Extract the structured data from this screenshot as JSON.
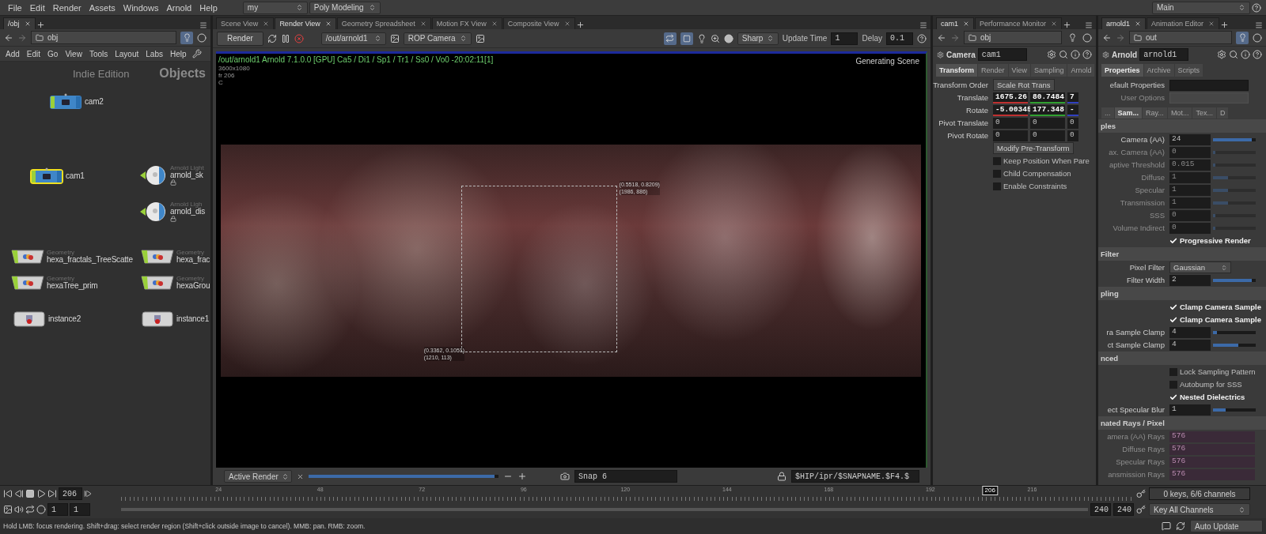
{
  "menubar": {
    "menus": [
      "File",
      "Edit",
      "Render",
      "Assets",
      "Windows",
      "Arnold",
      "Help"
    ],
    "desktop": "my",
    "shelf_set": "Poly Modeling",
    "context": "Main"
  },
  "network_pane": {
    "tabs": [
      {
        "label": "/obj",
        "selected": true
      }
    ],
    "path": "obj",
    "menus": [
      "Add",
      "Edit",
      "Go",
      "View",
      "Tools",
      "Layout",
      "Labs",
      "Help"
    ],
    "edition": "Indie Edition",
    "context_label": "Objects",
    "nodes": [
      {
        "kind": "camera",
        "name": "cam2",
        "selected": false
      },
      {
        "kind": "camera",
        "name": "cam1",
        "selected": true
      },
      {
        "kind": "light",
        "type_label": "Arnold Light",
        "name": "arnold_sk",
        "selected": false
      },
      {
        "kind": "light",
        "type_label": "Arnold Ligh",
        "name": "arnold_dis",
        "selected": false
      },
      {
        "kind": "geometry",
        "type_label": "Geometry",
        "name": "hexa_fractals_TreeScatte",
        "selected": false
      },
      {
        "kind": "geometry",
        "type_label": "Geometry",
        "name": "hexa_frac",
        "selected": false
      },
      {
        "kind": "geometry",
        "type_label": "Geometry",
        "name": "hexaTree_prim",
        "selected": false
      },
      {
        "kind": "geometry",
        "type_label": "Geometry",
        "name": "hexaGrou",
        "selected": false
      },
      {
        "kind": "instance",
        "name": "instance2",
        "selected": false
      },
      {
        "kind": "instance",
        "name": "instance1",
        "selected": false
      }
    ]
  },
  "viewer_pane": {
    "tabs": [
      {
        "label": "Scene View",
        "selected": false
      },
      {
        "label": "Render View",
        "selected": true
      },
      {
        "label": "Geometry Spreadsheet",
        "selected": false
      },
      {
        "label": "Motion FX View",
        "selected": false
      },
      {
        "label": "Composite View",
        "selected": false
      }
    ],
    "toolbar": {
      "render_button": "Render",
      "rop": "/out/arnold1",
      "camera": "ROP Camera",
      "preview": "Sharp",
      "update_time_label": "Update Time",
      "update_time": "1",
      "delay_label": "Delay",
      "delay": "0.1"
    },
    "hud": {
      "status_line": "/out/arnold1 Arnold 7.1.0.0 [GPU] Ca5 / Di1 / Sp1 / Tr1 / Ss0 / Vo0 -20:02:11[1]",
      "resolution": "3600x1080",
      "frame": "fr 206",
      "channel": "C",
      "progress": "Generating Scene"
    },
    "region": {
      "top_right": [
        "(0.5518, 0.8209)",
        "(1986, 886)"
      ],
      "bottom_left": [
        "(0.3362, 0.1051)",
        "(1210, 113)"
      ]
    },
    "bottom_bar": {
      "mode": "Active Render",
      "level": 0.98,
      "snap": "Snap 6",
      "snapshot_path": "$HIP/ipr/$SNAPNAME.$F4.$"
    }
  },
  "cam_pane": {
    "tabs": [
      {
        "label": "cam1",
        "selected": true
      },
      {
        "label": "Performance Monitor",
        "selected": false
      }
    ],
    "path": "obj",
    "node_type": "Camera",
    "node_name": "cam1",
    "param_tabs": [
      {
        "label": "Transform",
        "selected": true
      },
      {
        "label": "Render",
        "selected": false
      },
      {
        "label": "View",
        "selected": false
      },
      {
        "label": "Sampling",
        "selected": false
      },
      {
        "label": "Arnold",
        "selected": false
      }
    ],
    "params": [
      {
        "kind": "dropdown",
        "label": "Transform Order",
        "value": "Scale Rot Trans"
      },
      {
        "kind": "vector",
        "label": "Translate",
        "values": [
          "1675.26",
          "80.7484",
          "7"
        ],
        "keyed": true
      },
      {
        "kind": "vector",
        "label": "Rotate",
        "values": [
          "-5.00345",
          "177.348",
          "-"
        ],
        "keyed": true
      },
      {
        "kind": "vector",
        "label": "Pivot Translate",
        "values": [
          "0",
          "0",
          "0"
        ],
        "keyed": false
      },
      {
        "kind": "vector",
        "label": "Pivot Rotate",
        "values": [
          "0",
          "0",
          "0"
        ],
        "keyed": false
      },
      {
        "kind": "button",
        "label": "Modify Pre-Transform"
      },
      {
        "kind": "checkbox",
        "label": "Keep Position When Pare",
        "checked": false
      },
      {
        "kind": "checkbox",
        "label": "Child Compensation",
        "checked": false
      },
      {
        "kind": "checkbox",
        "label": "Enable Constraints",
        "checked": false
      }
    ]
  },
  "arnold_pane": {
    "tabs": [
      {
        "label": "arnold1",
        "selected": true
      },
      {
        "label": "Animation Editor",
        "selected": false
      }
    ],
    "path": "out",
    "node_type": "Arnold",
    "node_name": "arnold1",
    "param_tabs": [
      {
        "label": "Properties",
        "selected": true
      },
      {
        "label": "Archive",
        "selected": false
      },
      {
        "label": "Scripts",
        "selected": false
      }
    ],
    "params": [
      {
        "kind": "blank",
        "label": "efault Properties",
        "disabled": false
      },
      {
        "kind": "blank",
        "label": "User Options",
        "disabled": true
      },
      {
        "kind": "subtabs",
        "tabs": [
          {
            "label": "...",
            "selected": false
          },
          {
            "label": "Sam...",
            "selected": true
          },
          {
            "label": "Ray...",
            "selected": false
          },
          {
            "label": "Mot...",
            "selected": false
          },
          {
            "label": "Tex...",
            "selected": false
          },
          {
            "label": "D",
            "selected": false
          }
        ]
      },
      {
        "kind": "section",
        "label": "ples"
      },
      {
        "kind": "field",
        "label": "Camera (AA)",
        "value": "24",
        "disabled": false,
        "level": 0.9
      },
      {
        "kind": "field",
        "label": "ax. Camera (AA)",
        "value": "0",
        "disabled": true,
        "level": 0
      },
      {
        "kind": "field",
        "label": "aptive Threshold",
        "value": "0.015",
        "disabled": true,
        "level": 0
      },
      {
        "kind": "field",
        "label": "Diffuse",
        "value": "1",
        "disabled": true,
        "level": 0.35
      },
      {
        "kind": "field",
        "label": "Specular",
        "value": "1",
        "disabled": true,
        "level": 0.35
      },
      {
        "kind": "field",
        "label": "Transmission",
        "value": "1",
        "disabled": true,
        "level": 0.35
      },
      {
        "kind": "field",
        "label": "SSS",
        "value": "0",
        "disabled": true,
        "level": 0
      },
      {
        "kind": "field",
        "label": "Volume Indirect",
        "value": "0",
        "disabled": true,
        "level": 0
      },
      {
        "kind": "checkbox",
        "label": "Progressive Render",
        "checked": true
      },
      {
        "kind": "section",
        "label": "Filter"
      },
      {
        "kind": "dropdown",
        "label": "Pixel Filter",
        "value": "Gaussian"
      },
      {
        "kind": "field",
        "label": "Filter Width",
        "value": "2",
        "disabled": false,
        "level": 0.9
      },
      {
        "kind": "section",
        "label": "pling"
      },
      {
        "kind": "checkbox",
        "label": "Clamp Camera Sample",
        "checked": true
      },
      {
        "kind": "checkbox",
        "label": "Clamp Camera Sample",
        "checked": true
      },
      {
        "kind": "field",
        "label": "ra Sample Clamp",
        "value": "4",
        "disabled": false,
        "level": 0.1
      },
      {
        "kind": "field",
        "label": "ct Sample Clamp",
        "value": "4",
        "disabled": false,
        "level": 0.6
      },
      {
        "kind": "section",
        "label": "nced"
      },
      {
        "kind": "checkbox",
        "label": "Lock Sampling Pattern",
        "checked": false
      },
      {
        "kind": "checkbox",
        "label": "Autobump for SSS",
        "checked": false
      },
      {
        "kind": "checkbox",
        "label": "Nested Dielectrics",
        "checked": true
      },
      {
        "kind": "field",
        "label": "ect Specular Blur",
        "value": "1",
        "disabled": false,
        "level": 0.3
      },
      {
        "kind": "section",
        "label": "nated Rays / Pixel"
      },
      {
        "kind": "readout",
        "label": "amera (AA) Rays",
        "value": "576"
      },
      {
        "kind": "readout",
        "label": "Diffuse Rays",
        "value": "576"
      },
      {
        "kind": "readout",
        "label": "Specular Rays",
        "value": "576"
      },
      {
        "kind": "readout",
        "label": "ansmission Rays",
        "value": "576"
      }
    ]
  },
  "timeline": {
    "frame": "206",
    "ticks": [
      "24",
      "48",
      "72",
      "96",
      "120",
      "144",
      "168",
      "192",
      "216"
    ],
    "playhead": {
      "label": "206",
      "level": 0.858
    },
    "range": {
      "start": "1",
      "playback_start": "1",
      "playback_end": "240",
      "end": "240"
    },
    "keys_info": "0 keys, 6/6 channels",
    "key_button": "Key All Channels"
  },
  "status_bar": {
    "message": "Hold LMB: focus rendering. Shift+drag: select render region (Shift+click outside image to cancel). MMB: pan. RMB: zoom.",
    "auto_update": "Auto Update"
  }
}
